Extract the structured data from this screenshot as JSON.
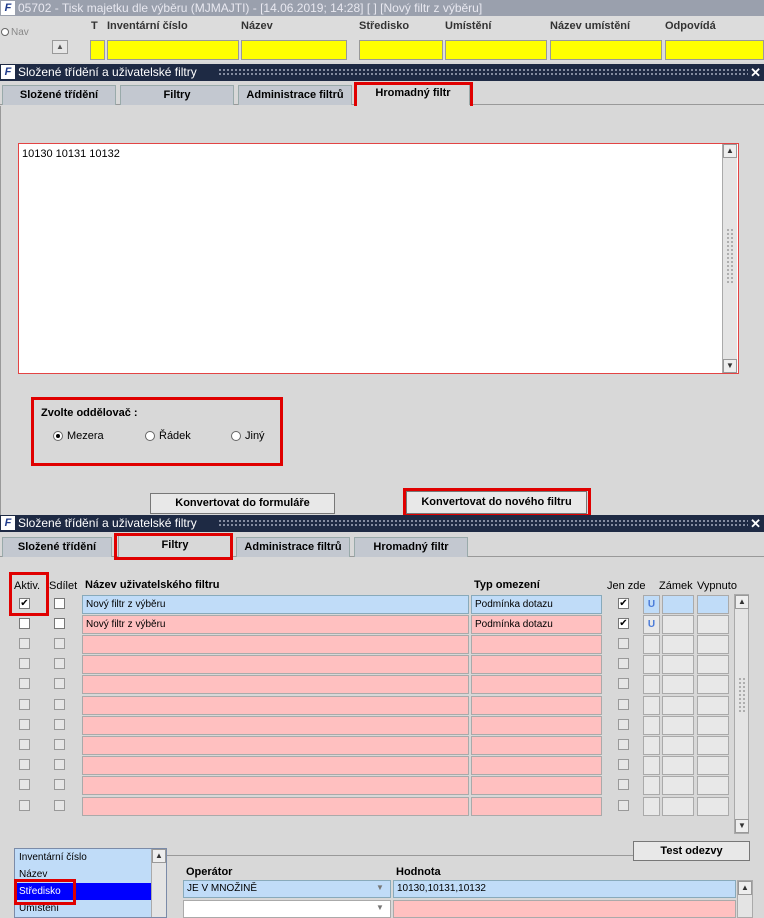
{
  "top_window": {
    "title": "05702 - Tisk majetku dle výběru (MJMAJTI) - [14.06.2019; 14:28]  [ ]  [Nový filtr z výběru]",
    "nav_label": "Nav",
    "headers": [
      "T",
      "Inventární číslo",
      "Název",
      "Středisko",
      "Umístění",
      "Název umístění",
      "Odpovídá"
    ]
  },
  "dialog1": {
    "title": "Složené třídění a uživatelské filtry",
    "tabs": [
      "Složené třídění",
      "Filtry",
      "Administrace filtrů",
      "Hromadný filtr"
    ],
    "active_tab": "Hromadný filtr",
    "text_value": "10130 10131 10132",
    "separator_label": "Zvolte oddělovač :",
    "radio_options": [
      {
        "label": "Mezera",
        "selected": true
      },
      {
        "label": "Řádek",
        "selected": false
      },
      {
        "label": "Jiný",
        "selected": false
      }
    ],
    "btn_convert_form": "Konvertovat do formuláře",
    "btn_convert_new": "Konvertovat do nového filtru"
  },
  "dialog2": {
    "title": "Složené třídění a uživatelské filtry",
    "tabs": [
      "Složené třídění",
      "Filtry",
      "Administrace filtrů",
      "Hromadný filtr"
    ],
    "active_tab": "Filtry",
    "columns": {
      "aktiv": "Aktiv.",
      "sdilet": "Sdílet",
      "nazev": "Název uživatelského filtru",
      "typ": "Typ omezení",
      "jen_zde": "Jen zde",
      "zamek": "Zámek",
      "vypnuto": "Vypnuto"
    },
    "rows": [
      {
        "aktiv": true,
        "sdilet": false,
        "nazev": "Nový filtr z výběru",
        "typ": "Podmínka dotazu",
        "jen_zde": true,
        "u": "U"
      },
      {
        "aktiv": false,
        "sdilet": false,
        "nazev": "Nový filtr z výběru",
        "typ": "Podmínka dotazu",
        "jen_zde": true,
        "u": "U"
      }
    ],
    "empty_rows": 9,
    "test_button": "Test odezvy",
    "condition_headers": {
      "operator": "Operátor",
      "hodnota": "Hodnota"
    },
    "condition_row": {
      "operator": "JE V MNOŽINĚ",
      "hodnota": "10130,10131,10132"
    },
    "field_list": [
      "Inventární číslo",
      "Název",
      "Středisko",
      "Umístění"
    ],
    "field_list_selected": "Středisko"
  }
}
